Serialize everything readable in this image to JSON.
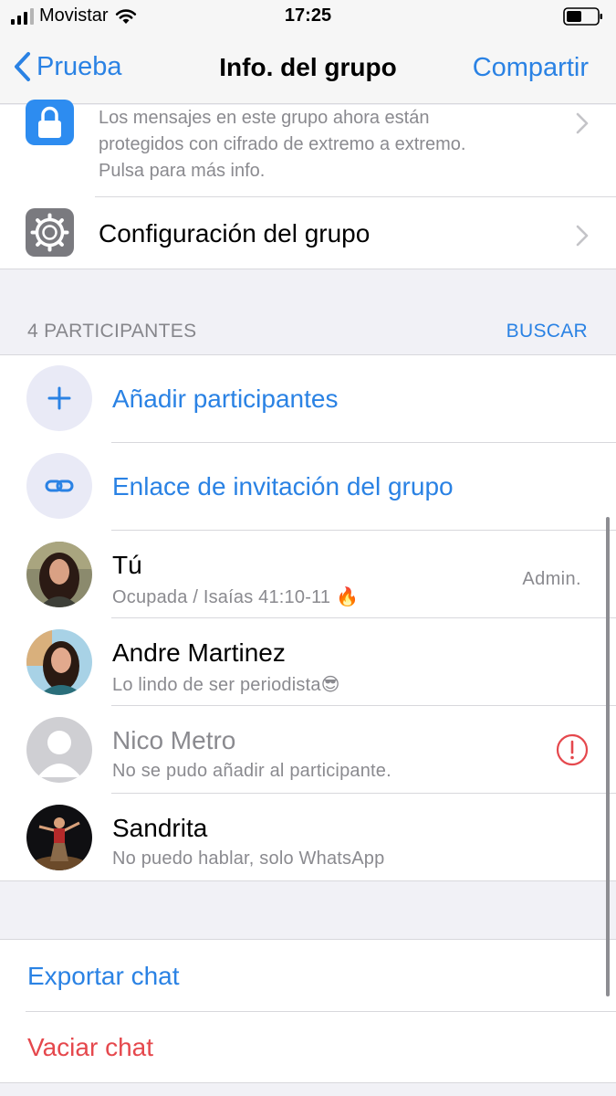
{
  "status_bar": {
    "carrier": "Movistar",
    "time": "17:25"
  },
  "nav": {
    "back_label": "Prueba",
    "title": "Info. del grupo",
    "share_label": "Compartir"
  },
  "encryption": {
    "line1": "Los mensajes en este grupo ahora están",
    "line2": "protegidos con cifrado de extremo a extremo.",
    "line3": "Pulsa para más info."
  },
  "group_settings_label": "Configuración del grupo",
  "participants_header": {
    "count_label": "4 PARTICIPANTES",
    "search_label": "BUSCAR"
  },
  "actions": {
    "add_participants": "Añadir participantes",
    "invite_link": "Enlace de invitación del grupo"
  },
  "participants": [
    {
      "name": "Tú",
      "status": "Ocupada / Isaías 41:10-11 🔥",
      "role": "Admin."
    },
    {
      "name": "Andre Martinez",
      "status": "Lo lindo de ser periodista😎",
      "role": ""
    },
    {
      "name": "Nico Metro",
      "status": "No se pudo añadir al participante.",
      "role": ""
    },
    {
      "name": "Sandrita",
      "status": "No puedo hablar, solo WhatsApp",
      "role": ""
    }
  ],
  "chat_actions": {
    "export_label": "Exportar chat",
    "clear_label": "Vaciar chat"
  },
  "colors": {
    "accent": "#2a82e4",
    "destructive": "#e5484d",
    "secondary_text": "#8a8a8f",
    "background": "#f1f1f6"
  }
}
